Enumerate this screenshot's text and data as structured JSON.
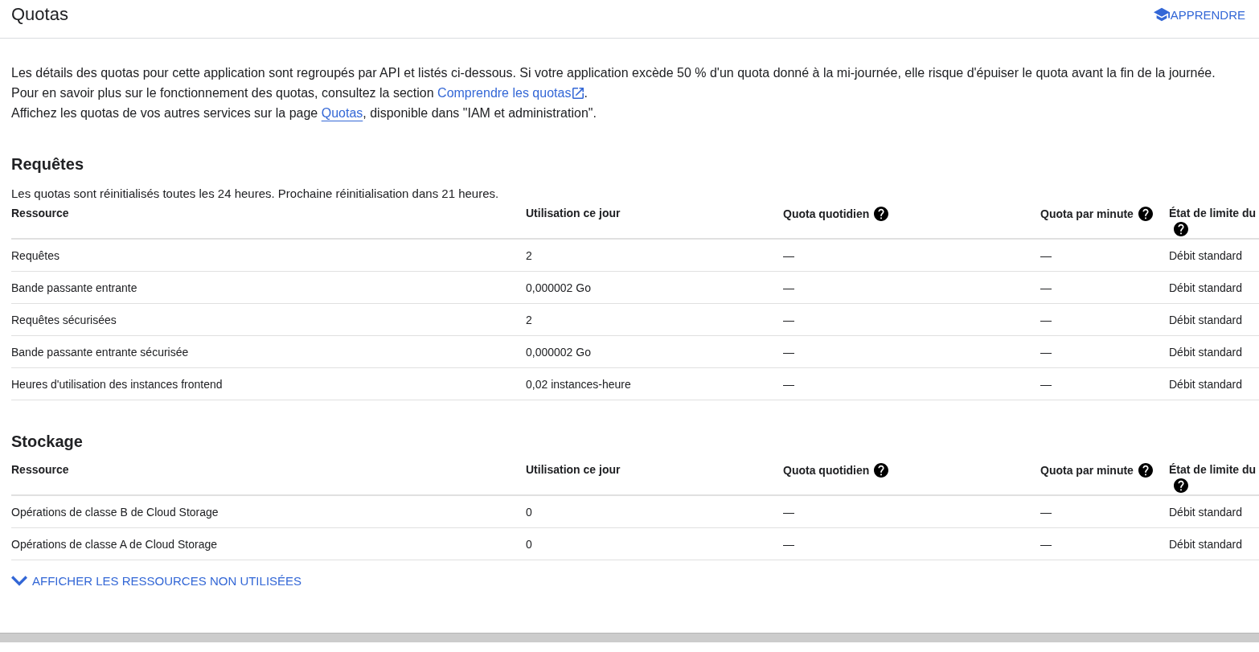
{
  "header": {
    "title": "Quotas",
    "learn_button": "APPRENDRE"
  },
  "intro": [
    {
      "parts": [
        {
          "kind": "text",
          "text": "Les détails des quotas pour cette application sont regroupés par API et listés ci-dessous. Si votre application excède 50 % d'un quota donné à la mi-journée, elle risque d'épuiser le quota avant la fin de la journée."
        }
      ]
    },
    {
      "parts": [
        {
          "kind": "text",
          "text": "Pour en savoir plus sur le fonctionnement des quotas, consultez la section "
        },
        {
          "kind": "external_link",
          "text": "Comprendre les quotas"
        },
        {
          "kind": "text",
          "text": "."
        }
      ]
    },
    {
      "parts": [
        {
          "kind": "text",
          "text": "Affichez les quotas de vos autres services sur la page "
        },
        {
          "kind": "underlined_link",
          "text": "Quotas"
        },
        {
          "kind": "text",
          "text": ", disponible dans \"IAM et administration\"."
        }
      ]
    }
  ],
  "sections": [
    {
      "title": "Requêtes",
      "note": "Les quotas sont réinitialisés toutes les 24 heures. Prochaine réinitialisation dans 21 heures.",
      "columns": [
        {
          "label": "Ressource",
          "help": false
        },
        {
          "label": "Utilisation ce jour",
          "help": false
        },
        {
          "label": "Quota quotidien",
          "help": true
        },
        {
          "label": "Quota par minute",
          "help": true
        },
        {
          "label": "État de limite du",
          "help": true
        }
      ],
      "rows": [
        [
          "Requêtes",
          "2",
          "—",
          "—",
          "Débit standard"
        ],
        [
          "Bande passante entrante",
          "0,000002 Go",
          "—",
          "—",
          "Débit standard"
        ],
        [
          "Requêtes sécurisées",
          "2",
          "—",
          "—",
          "Débit standard"
        ],
        [
          "Bande passante entrante sécurisée",
          "0,000002 Go",
          "—",
          "—",
          "Débit standard"
        ],
        [
          "Heures d'utilisation des instances frontend",
          "0,02 instances-heure",
          "—",
          "—",
          "Débit standard"
        ]
      ]
    },
    {
      "title": "Stockage",
      "columns": [
        {
          "label": "Ressource",
          "help": false
        },
        {
          "label": "Utilisation ce jour",
          "help": false
        },
        {
          "label": "Quota quotidien",
          "help": true
        },
        {
          "label": "Quota par minute",
          "help": true
        },
        {
          "label": "État de limite du",
          "help": true
        }
      ],
      "rows": [
        [
          "Opérations de classe B de Cloud Storage",
          "0",
          "—",
          "—",
          "Débit standard"
        ],
        [
          "Opérations de classe A de Cloud Storage",
          "0",
          "—",
          "—",
          "Débit standard"
        ]
      ]
    }
  ],
  "show_unused": {
    "label": "AFFICHER LES RESSOURCES NON UTILISÉES",
    "expanded": false
  }
}
